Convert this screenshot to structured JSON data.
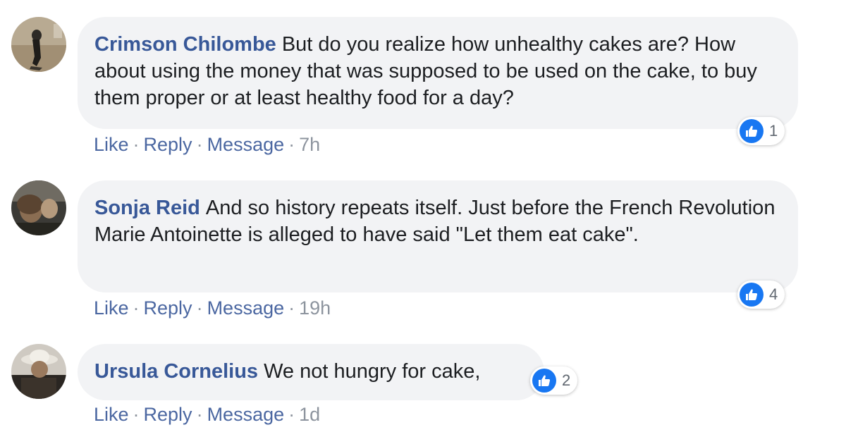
{
  "colors": {
    "author_name": "#385898",
    "action_link": "#4b67a1",
    "timestamp": "#8d949e",
    "bubble_bg": "#f2f3f5",
    "like_blue": "#1877f2"
  },
  "comments": [
    {
      "author": "Crimson Chilombe",
      "text": "But do you realize how unhealthy cakes are? How about using the money that was supposed to be used on the cake, to buy them proper or at least healthy food for a day?",
      "actions": {
        "like": "Like",
        "reply": "Reply",
        "message": "Message"
      },
      "separator": "·",
      "time": "7h",
      "reaction_icon": "like-thumbs-up-icon",
      "reaction_count": "1"
    },
    {
      "author": "Sonja Reid",
      "text": "And so history repeats itself. Just before the French Revolution Marie Antoinette is alleged to have said \"Let them eat cake\".",
      "actions": {
        "like": "Like",
        "reply": "Reply",
        "message": "Message"
      },
      "separator": "·",
      "time": "19h",
      "reaction_icon": "like-thumbs-up-icon",
      "reaction_count": "4"
    },
    {
      "author": "Ursula Cornelius",
      "text": "We not hungry for cake,",
      "actions": {
        "like": "Like",
        "reply": "Reply",
        "message": "Message"
      },
      "separator": "·",
      "time": "1d",
      "reaction_icon": "like-thumbs-up-icon",
      "reaction_count": "2"
    }
  ]
}
